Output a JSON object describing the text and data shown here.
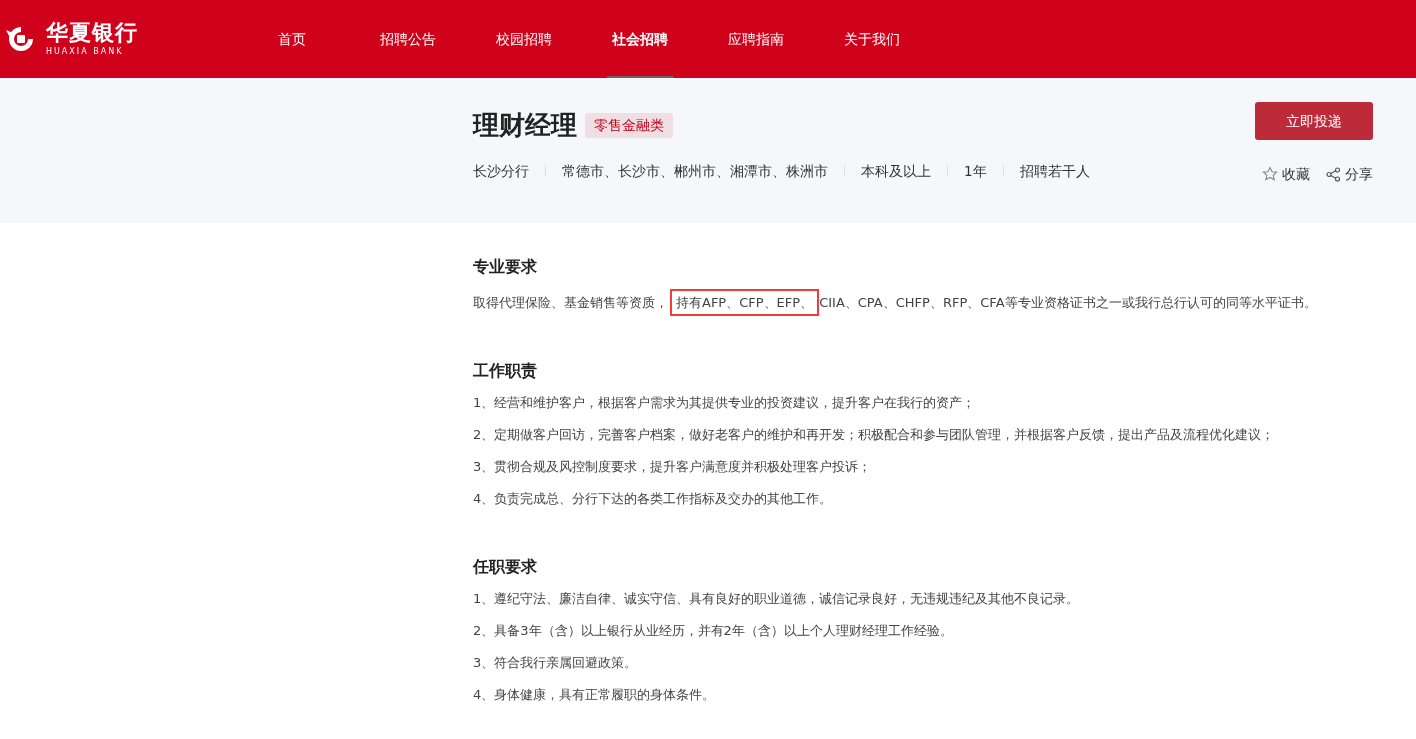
{
  "header": {
    "logo": {
      "name": "华夏银行",
      "subtitle": "HUAXIA BANK"
    },
    "nav": [
      {
        "label": "首页",
        "selected": false
      },
      {
        "label": "招聘公告",
        "selected": false
      },
      {
        "label": "校园招聘",
        "selected": false
      },
      {
        "label": "社会招聘",
        "selected": true
      },
      {
        "label": "应聘指南",
        "selected": false
      },
      {
        "label": "关于我们",
        "selected": false
      }
    ]
  },
  "job": {
    "title": "理财经理",
    "tag": "零售金融类",
    "meta": [
      "长沙分行",
      "常德市、长沙市、郴州市、湘潭市、株洲市",
      "本科及以上",
      "1年",
      "招聘若干人"
    ],
    "apply_button": "立即投递",
    "favorite": "收藏",
    "share": "分享"
  },
  "sections": [
    {
      "heading": "专业要求",
      "kind": "highlighted",
      "paragraph": {
        "before": "取得代理保险、基金销售等资质，",
        "highlight": "持有AFP、CFP、EFP、",
        "after": "CIIA、CPA、CHFP、RFP、CFA等专业资格证书之一或我行总行认可的同等水平证书。"
      }
    },
    {
      "heading": "工作职责",
      "kind": "list",
      "items": [
        " 1、经营和维护客户，根据客户需求为其提供专业的投资建议，提升客户在我行的资产；",
        "2、定期做客户回访，完善客户档案，做好老客户的维护和再开发；积极配合和参与团队管理，并根据客户反馈，提出产品及流程优化建议；",
        "3、贯彻合规及风控制度要求，提升客户满意度并积极处理客户投诉；",
        "4、负责完成总、分行下达的各类工作指标及交办的其他工作。"
      ]
    },
    {
      "heading": "任职要求",
      "kind": "list",
      "items": [
        "1、遵纪守法、廉洁自律、诚实守信、具有良好的职业道德，诚信记录良好，无违规违纪及其他不良记录。",
        "2、具备3年（含）以上银行从业经历，并有2年（含）以上个人理财经理工作经验。",
        "3、符合我行亲属回避政策。",
        "4、身体健康，具有正常履职的身体条件。"
      ]
    }
  ]
}
